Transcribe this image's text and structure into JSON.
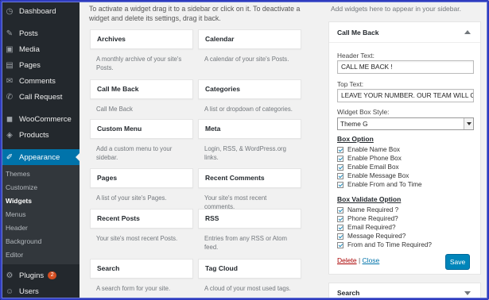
{
  "sidebar": {
    "items": [
      {
        "label": "Dashboard",
        "icon": "dashboard-icon",
        "glyph": "◷"
      },
      {
        "label": "Posts",
        "icon": "pin-icon",
        "glyph": "✎"
      },
      {
        "label": "Media",
        "icon": "media-icon",
        "glyph": "▣"
      },
      {
        "label": "Pages",
        "icon": "pages-icon",
        "glyph": "▤"
      },
      {
        "label": "Comments",
        "icon": "comments-icon",
        "glyph": "✉"
      },
      {
        "label": "Call Request",
        "icon": "wrench-icon",
        "glyph": "✆"
      },
      {
        "label": "WooCommerce",
        "icon": "woo-icon",
        "glyph": "◼"
      },
      {
        "label": "Products",
        "icon": "products-icon",
        "glyph": "◈"
      },
      {
        "label": "Appearance",
        "icon": "brush-icon",
        "glyph": "✐"
      }
    ],
    "submenu": [
      "Themes",
      "Customize",
      "Widgets",
      "Menus",
      "Header",
      "Background",
      "Editor"
    ],
    "after": [
      {
        "label": "Plugins",
        "icon": "plugin-icon",
        "glyph": "⚙",
        "badge": "2"
      },
      {
        "label": "Users",
        "icon": "users-icon",
        "glyph": "☺"
      }
    ]
  },
  "intro": "To activate a widget drag it to a sidebar or click on it. To deactivate a widget and delete its settings, drag it back.",
  "widgets": [
    {
      "title": "Archives",
      "desc": "A monthly archive of your site's Posts."
    },
    {
      "title": "Calendar",
      "desc": "A calendar of your site's Posts."
    },
    {
      "title": "Call Me Back",
      "desc": "Call Me Back"
    },
    {
      "title": "Categories",
      "desc": "A list or dropdown of categories."
    },
    {
      "title": "Custom Menu",
      "desc": "Add a custom menu to your sidebar."
    },
    {
      "title": "Meta",
      "desc": "Login, RSS, & WordPress.org links."
    },
    {
      "title": "Pages",
      "desc": "A list of your site's Pages."
    },
    {
      "title": "Recent Comments",
      "desc": "Your site's most recent comments."
    },
    {
      "title": "Recent Posts",
      "desc": "Your site's most recent Posts."
    },
    {
      "title": "RSS",
      "desc": "Entries from any RSS or Atom feed."
    },
    {
      "title": "Search",
      "desc": "A search form for your site."
    },
    {
      "title": "Tag Cloud",
      "desc": "A cloud of your most used tags."
    }
  ],
  "right": {
    "top_text": "Add widgets here to appear in your sidebar.",
    "panel_title": "Call Me Back",
    "header_label": "Header Text:",
    "header_value": "CALL ME BACK !",
    "top_label": "Top Text:",
    "top_value": "LEAVE YOUR NUMBER. OUR TEAM WILL C",
    "style_label": "Widget Box Style:",
    "style_value": "Theme G",
    "box_option_title": "Box Option",
    "box_options": [
      "Enable Name Box",
      "Enable Phone Box",
      "Enable Email Box",
      "Enable Message Box",
      "Enable From and To Time"
    ],
    "validate_title": "Box Validate Option",
    "validate_options": [
      "Name Required ?",
      "Phone Required?",
      "Email Required?",
      "Message Required?",
      "From and To Time Required?"
    ],
    "delete_label": "Delete",
    "separator": "|",
    "close_label": "Close",
    "save_label": "Save",
    "search_panel_title": "Search"
  }
}
